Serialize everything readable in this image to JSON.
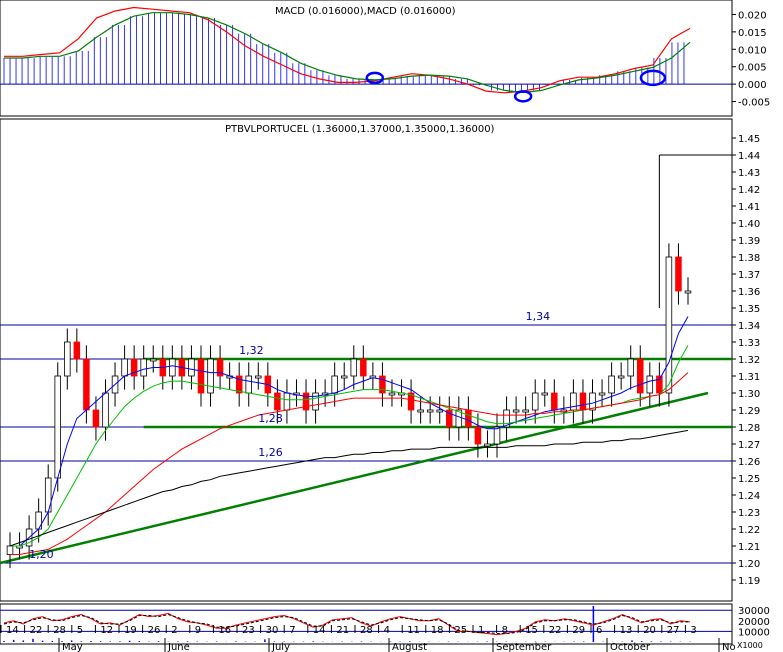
{
  "chart_data": [
    {
      "type": "line",
      "panel": "macd",
      "title": "MACD (0.016000),MACD (0.016000)",
      "ylim": [
        -0.008,
        0.023
      ],
      "yticks": [
        "0.020",
        "0.015",
        "0.010",
        "0.005",
        "0.000",
        "-0.005"
      ],
      "series": [
        {
          "name": "",
          "color": "#ff0000",
          "values": [
            0.008,
            0.008,
            0.0085,
            0.009,
            0.013,
            0.019,
            0.021,
            0.022,
            0.0215,
            0.021,
            0.0205,
            0.0185,
            0.015,
            0.011,
            0.008,
            0.0055,
            0.003,
            0.0015,
            0.0005,
            0.0005,
            0.001,
            0.002,
            0.003,
            0.0025,
            0.0015,
            0.0,
            -0.002,
            -0.0025,
            -0.002,
            -0.001,
            0.001,
            0.002,
            0.002,
            0.003,
            0.0045,
            0.0055,
            0.013,
            0.016
          ]
        },
        {
          "name": "",
          "color": "#008000",
          "values": [
            0.0075,
            0.0075,
            0.008,
            0.008,
            0.0095,
            0.0135,
            0.017,
            0.0195,
            0.0205,
            0.0205,
            0.02,
            0.019,
            0.017,
            0.0145,
            0.0115,
            0.009,
            0.006,
            0.004,
            0.0025,
            0.0015,
            0.0012,
            0.0016,
            0.0023,
            0.0026,
            0.0023,
            0.0015,
            -0.0003,
            -0.0018,
            -0.0024,
            -0.0018,
            -0.0002,
            0.0012,
            0.0018,
            0.0026,
            0.0037,
            0.0048,
            0.0075,
            0.012
          ]
        }
      ],
      "histogram": [
        0.0075,
        0.0075,
        0.008,
        0.008,
        0.0095,
        0.0135,
        0.017,
        0.0195,
        0.0205,
        0.0205,
        0.02,
        0.019,
        0.017,
        0.0145,
        0.0115,
        0.009,
        0.006,
        0.004,
        0.0025,
        0.0015,
        0.0012,
        0.0016,
        0.0023,
        0.0026,
        0.0023,
        0.0015,
        -0.0003,
        -0.0018,
        -0.0024,
        -0.0018,
        -0.0002,
        0.0012,
        0.0018,
        0.0026,
        0.0037,
        0.0048,
        0.0075,
        0.012
      ],
      "markers": [
        {
          "i": 20,
          "v": 0.0018
        },
        {
          "i": 28,
          "v": -0.0035
        },
        {
          "i": 35,
          "v": 0.0018
        }
      ]
    },
    {
      "type": "candlestick",
      "panel": "price",
      "title": "PTBVLPORTUCEL (1.36000,1.37000,1.35000,1.36000)",
      "ylim": [
        1.18,
        1.45
      ],
      "yticks": [
        "1.45",
        "1.44",
        "1.43",
        "1.42",
        "1.41",
        "1.40",
        "1.39",
        "1.38",
        "1.37",
        "1.36",
        "1.35",
        "1.34",
        "1.33",
        "1.32",
        "1.31",
        "1.30",
        "1.29",
        "1.28",
        "1.27",
        "1.26",
        "1.25",
        "1.24",
        "1.23",
        "1.22",
        "1.21",
        "1.20",
        "1.19"
      ],
      "close": [
        1.21,
        1.21,
        1.22,
        1.23,
        1.25,
        1.31,
        1.33,
        1.32,
        1.29,
        1.28,
        1.3,
        1.31,
        1.32,
        1.31,
        1.32,
        1.32,
        1.31,
        1.32,
        1.31,
        1.32,
        1.3,
        1.32,
        1.31,
        1.31,
        1.3,
        1.31,
        1.31,
        1.3,
        1.29,
        1.3,
        1.3,
        1.29,
        1.3,
        1.3,
        1.31,
        1.31,
        1.32,
        1.31,
        1.31,
        1.3,
        1.3,
        1.3,
        1.29,
        1.29,
        1.29,
        1.29,
        1.28,
        1.29,
        1.28,
        1.27,
        1.27,
        1.28,
        1.29,
        1.29,
        1.29,
        1.3,
        1.3,
        1.29,
        1.29,
        1.3,
        1.29,
        1.3,
        1.3,
        1.31,
        1.31,
        1.32,
        1.3,
        1.31,
        1.3,
        1.38,
        1.36,
        1.36
      ],
      "ma_series": [
        {
          "color": "#0000ff",
          "values": [
            1.21,
            1.21,
            1.215,
            1.22,
            1.23,
            1.25,
            1.27,
            1.285,
            1.29,
            1.295,
            1.3,
            1.305,
            1.31,
            1.312,
            1.314,
            1.315,
            1.315,
            1.316,
            1.315,
            1.314,
            1.313,
            1.312,
            1.312,
            1.31,
            1.308,
            1.307,
            1.306,
            1.305,
            1.302,
            1.3,
            1.299,
            1.298,
            1.298,
            1.299,
            1.3,
            1.302,
            1.305,
            1.307,
            1.309,
            1.308,
            1.306,
            1.304,
            1.302,
            1.298,
            1.294,
            1.291,
            1.288,
            1.286,
            1.284,
            1.281,
            1.279,
            1.279,
            1.281,
            1.283,
            1.285,
            1.287,
            1.289,
            1.29,
            1.291,
            1.292,
            1.293,
            1.294,
            1.296,
            1.298,
            1.3,
            1.303,
            1.305,
            1.307,
            1.308,
            1.318,
            1.335,
            1.345
          ]
        },
        {
          "color": "#00c000",
          "values": [
            1.21,
            1.21,
            1.212,
            1.215,
            1.22,
            1.23,
            1.24,
            1.25,
            1.26,
            1.27,
            1.278,
            1.285,
            1.292,
            1.297,
            1.301,
            1.304,
            1.306,
            1.307,
            1.307,
            1.306,
            1.305,
            1.304,
            1.303,
            1.302,
            1.301,
            1.3,
            1.299,
            1.298,
            1.297,
            1.296,
            1.296,
            1.296,
            1.297,
            1.298,
            1.299,
            1.3,
            1.301,
            1.302,
            1.302,
            1.302,
            1.301,
            1.3,
            1.299,
            1.297,
            1.295,
            1.293,
            1.291,
            1.289,
            1.287,
            1.285,
            1.283,
            1.282,
            1.282,
            1.283,
            1.284,
            1.285,
            1.286,
            1.287,
            1.288,
            1.289,
            1.29,
            1.291,
            1.292,
            1.293,
            1.294,
            1.296,
            1.297,
            1.298,
            1.299,
            1.305,
            1.318,
            1.328
          ]
        },
        {
          "color": "#ff0000",
          "values": [
            1.205,
            1.205,
            1.206,
            1.207,
            1.208,
            1.211,
            1.214,
            1.218,
            1.222,
            1.226,
            1.23,
            1.235,
            1.24,
            1.245,
            1.25,
            1.255,
            1.259,
            1.263,
            1.267,
            1.27,
            1.273,
            1.276,
            1.279,
            1.281,
            1.283,
            1.285,
            1.287,
            1.288,
            1.289,
            1.29,
            1.291,
            1.292,
            1.293,
            1.294,
            1.295,
            1.296,
            1.297,
            1.297,
            1.297,
            1.297,
            1.297,
            1.297,
            1.296,
            1.295,
            1.294,
            1.293,
            1.292,
            1.291,
            1.29,
            1.289,
            1.288,
            1.287,
            1.287,
            1.287,
            1.287,
            1.288,
            1.288,
            1.289,
            1.289,
            1.29,
            1.29,
            1.291,
            1.292,
            1.293,
            1.294,
            1.295,
            1.296,
            1.298,
            1.299,
            1.302,
            1.307,
            1.312
          ]
        },
        {
          "color": "#000000",
          "values": [
            1.21,
            1.212,
            1.214,
            1.216,
            1.218,
            1.22,
            1.222,
            1.224,
            1.226,
            1.228,
            1.23,
            1.232,
            1.234,
            1.236,
            1.238,
            1.24,
            1.242,
            1.243,
            1.245,
            1.246,
            1.248,
            1.249,
            1.251,
            1.252,
            1.253,
            1.254,
            1.255,
            1.256,
            1.257,
            1.258,
            1.259,
            1.26,
            1.261,
            1.262,
            1.262,
            1.263,
            1.264,
            1.264,
            1.265,
            1.265,
            1.266,
            1.266,
            1.267,
            1.267,
            1.267,
            1.268,
            1.268,
            1.268,
            1.268,
            1.268,
            1.268,
            1.268,
            1.268,
            1.269,
            1.269,
            1.269,
            1.269,
            1.27,
            1.27,
            1.27,
            1.271,
            1.271,
            1.271,
            1.272,
            1.272,
            1.273,
            1.273,
            1.274,
            1.275,
            1.276,
            1.277,
            1.278
          ]
        }
      ],
      "high_spike": {
        "i": 68,
        "high": 1.44
      },
      "horizontal_levels": [
        1.34,
        1.32,
        1.28,
        1.26,
        1.2
      ],
      "level_labels": [
        {
          "text": "1,34",
          "level": 1.34,
          "x_index": 54
        },
        {
          "text": "1,32",
          "level": 1.32,
          "x_index": 24
        },
        {
          "text": "1,28",
          "level": 1.28,
          "x_index": 26
        },
        {
          "text": "1,26",
          "level": 1.26,
          "x_index": 26
        },
        {
          "text": "1,20",
          "level": 1.2,
          "x_index": 2
        }
      ],
      "channel": {
        "top": 1.32,
        "bottom": 1.28,
        "from_index": 14,
        "to_index": 72,
        "color": "#008000"
      },
      "trendline": {
        "from": {
          "i": 0,
          "v": 1.2
        },
        "to": {
          "i": 72,
          "v": 1.3
        },
        "color": "#008000"
      }
    },
    {
      "type": "line",
      "panel": "volume",
      "yticks": [
        "30000",
        "20000",
        "10000"
      ],
      "unit_label": "X1000",
      "ylim": [
        0,
        34000
      ],
      "series": [
        {
          "name": "",
          "color": "#ff0000",
          "values": [
            18000,
            20000,
            17000,
            22000,
            24000,
            20000,
            21000,
            24000,
            26000,
            22000,
            17000,
            18000,
            16000,
            21000,
            26000,
            24000,
            25000,
            27000,
            22000,
            19000,
            18000,
            16000,
            13000,
            13000,
            16000,
            18000,
            20000,
            22000,
            24000,
            25000,
            22000,
            18000,
            14000,
            16000,
            21000,
            22000,
            23000,
            18000,
            15000,
            19000,
            22000,
            24000,
            22000,
            20000,
            20000,
            22000,
            16000,
            10000,
            10000,
            9000,
            8000,
            7000,
            8000,
            10000,
            13000,
            19000,
            21000,
            20000,
            22000,
            20000,
            18000,
            16000,
            19000,
            22000,
            26000,
            22000,
            18000,
            21000,
            22000,
            17000,
            20000,
            19000
          ]
        },
        {
          "name": "",
          "color": "#000000",
          "values": [
            17000,
            19000,
            18000,
            21000,
            23000,
            21000,
            20000,
            23000,
            25000,
            23000,
            18000,
            17000,
            17000,
            20000,
            25000,
            25000,
            24000,
            26000,
            23000,
            20000,
            18000,
            17000,
            14000,
            14000,
            15000,
            17000,
            19000,
            21000,
            23000,
            24000,
            23000,
            19000,
            15000,
            15000,
            20000,
            21000,
            22000,
            19000,
            16000,
            18000,
            21000,
            23000,
            22000,
            21000,
            20000,
            21000,
            17000,
            11000,
            10000,
            9000,
            9000,
            8000,
            8000,
            9000,
            12000,
            18000,
            20000,
            20000,
            21000,
            21000,
            19000,
            17000,
            18000,
            21000,
            25000,
            23000,
            19000,
            20000,
            21000,
            18000,
            19000,
            19000
          ]
        }
      ],
      "bars": [
        1000,
        2000,
        1500,
        3000,
        1200,
        1000,
        800,
        1500,
        600,
        900,
        700,
        500,
        600,
        1200,
        800,
        400,
        700,
        300,
        500,
        600,
        400,
        300,
        500,
        200,
        600,
        400,
        300,
        2500,
        500,
        400,
        300,
        400,
        600,
        300,
        200,
        400,
        300,
        500,
        300,
        200,
        400,
        300,
        600,
        200,
        300,
        200,
        400,
        300,
        200,
        300,
        500,
        300,
        400,
        200,
        300,
        400,
        300,
        200,
        300,
        400,
        500,
        34000,
        300,
        200,
        300,
        1500,
        800,
        600,
        500,
        400,
        300,
        300
      ]
    }
  ],
  "x_axis": {
    "day_labels": [
      "14",
      "22",
      "28",
      "5",
      "12",
      "19",
      "26",
      "2",
      "9",
      "16",
      "23",
      "30",
      "7",
      "14",
      "21",
      "28",
      "4",
      "11",
      "18",
      "25",
      "1",
      "8",
      "15",
      "22",
      "29",
      "6",
      "13",
      "20",
      "27",
      "3"
    ],
    "month_labels": [
      "May",
      "June",
      "July",
      "August",
      "September",
      "October",
      "No"
    ]
  },
  "colors": {
    "background": "#ffffff",
    "grid_levels": "#0000a0",
    "up_candle": "#ffffff",
    "down_candle": "#ff0000",
    "marker": "#0000ff"
  }
}
